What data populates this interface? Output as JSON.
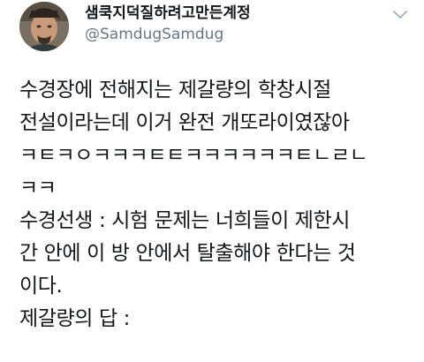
{
  "tweet": {
    "display_name": "샘쿡지덕질하려고만든계정",
    "handle": "@SamdugSamdug",
    "lines": [
      "수경장에 전해지는 제갈량의 학창시절",
      "전설이라는데 이거 완전 개또라이였잖아",
      "ㅋㅌㅋㅇㅋㅋㅋㅌㅌㅋㅋㅋㅋㅋㅋㅌㄴㄹㄴ",
      "ㅋㅋ",
      "수경선생 : 시험 문제는 너희들이 제한시",
      "간 안에 이 방 안에서 탈출해야 한다는 것",
      "이다.",
      "제갈량의 답 :"
    ]
  },
  "icons": {
    "avatar": "avatar-photo",
    "caret": "chevron-down-icon"
  },
  "colors": {
    "text": "#14171a",
    "secondary": "#657786",
    "caret": "#aab8c2"
  }
}
